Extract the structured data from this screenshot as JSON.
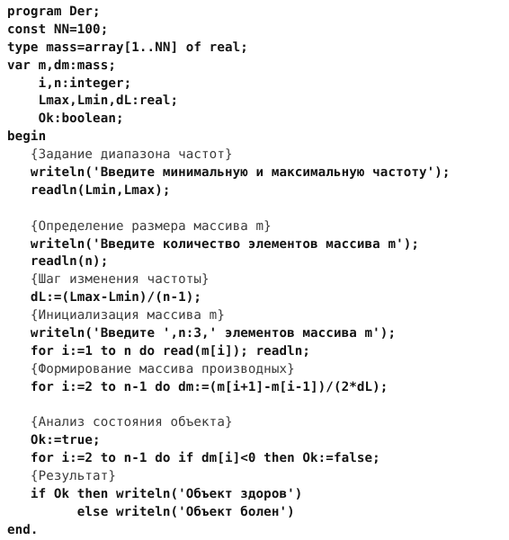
{
  "document": {
    "kind": "source-code-listing",
    "language": "Pascal",
    "program_name": "Der",
    "background_color": "#ffffff",
    "text_color": "#131313",
    "comment_color": "#3a3a3a"
  },
  "code": {
    "lines": [
      {
        "text": "program Der;",
        "comment": false
      },
      {
        "text": "const NN=100;",
        "comment": false
      },
      {
        "text": "type mass=array[1..NN] of real;",
        "comment": false
      },
      {
        "text": "var m,dm:mass;",
        "comment": false
      },
      {
        "text": "    i,n:integer;",
        "comment": false
      },
      {
        "text": "    Lmax,Lmin,dL:real;",
        "comment": false
      },
      {
        "text": "    Ok:boolean;",
        "comment": false
      },
      {
        "text": "begin",
        "comment": false
      },
      {
        "text": "   {Задание диапазона частот}",
        "comment": true
      },
      {
        "text": "   writeln('Введите минимальную и максимальную частоту');",
        "comment": false
      },
      {
        "text": "   readln(Lmin,Lmax);",
        "comment": false
      },
      {
        "text": "",
        "comment": false
      },
      {
        "text": "   {Определение размера массива m}",
        "comment": true
      },
      {
        "text": "   writeln('Введите количество элементов массива m');",
        "comment": false
      },
      {
        "text": "   readln(n);",
        "comment": false
      },
      {
        "text": "   {Шаг изменения частоты}",
        "comment": true
      },
      {
        "text": "   dL:=(Lmax-Lmin)/(n-1);",
        "comment": false
      },
      {
        "text": "   {Инициализация массива m}",
        "comment": true
      },
      {
        "text": "   writeln('Введите ',n:3,' элементов массива m');",
        "comment": false
      },
      {
        "text": "   for i:=1 to n do read(m[i]); readln;",
        "comment": false
      },
      {
        "text": "   {Формирование массива производных}",
        "comment": true
      },
      {
        "text": "   for i:=2 to n-1 do dm:=(m[i+1]-m[i-1])/(2*dL);",
        "comment": false
      },
      {
        "text": "",
        "comment": false
      },
      {
        "text": "   {Анализ состояния объекта}",
        "comment": true
      },
      {
        "text": "   Ok:=true;",
        "comment": false
      },
      {
        "text": "   for i:=2 to n-1 do if dm[i]<0 then Ok:=false;",
        "comment": false
      },
      {
        "text": "   {Результат}",
        "comment": true
      },
      {
        "text": "   if Ok then writeln('Объект здоров')",
        "comment": false
      },
      {
        "text": "         else writeln('Объект болен')",
        "comment": false
      },
      {
        "text": "end.",
        "comment": false
      }
    ]
  }
}
